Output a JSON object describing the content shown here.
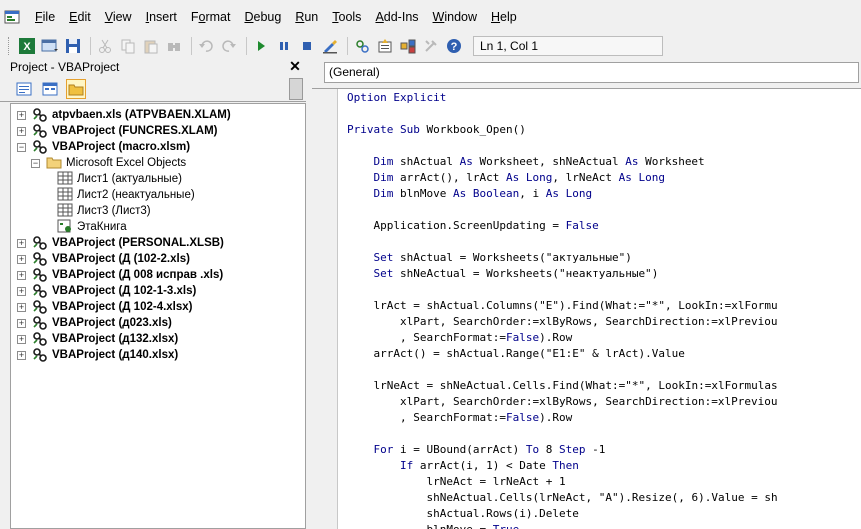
{
  "menu": [
    "File",
    "Edit",
    "View",
    "Insert",
    "Format",
    "Debug",
    "Run",
    "Tools",
    "Add-Ins",
    "Window",
    "Help"
  ],
  "menu_underline": [
    "F",
    "E",
    "V",
    "I",
    "o",
    "D",
    "R",
    "T",
    "A",
    "W",
    "H"
  ],
  "toolbar": {
    "position": "Ln 1, Col 1",
    "icons": [
      "excel-icon",
      "insert-userform-icon",
      "save-icon",
      "cut-icon",
      "copy-icon",
      "paste-icon",
      "find-icon",
      "undo-icon",
      "redo-icon",
      "run-icon",
      "break-icon",
      "reset-icon",
      "design-mode-icon",
      "project-explorer-icon",
      "properties-icon",
      "object-browser-icon",
      "toolbox-icon",
      "help-icon"
    ]
  },
  "project": {
    "title": "Project - VBAProject",
    "close_glyph": "✕",
    "tree": [
      {
        "label": "atpvbaen.xls (ATPVBAEN.XLAM)",
        "level": 0,
        "type": "project",
        "expander": "+",
        "bold": true
      },
      {
        "label": "VBAProject (FUNCRES.XLAM)",
        "level": 0,
        "type": "project",
        "expander": "+",
        "bold": true
      },
      {
        "label": "VBAProject (macro.xlsm)",
        "level": 0,
        "type": "project",
        "expander": "−",
        "bold": true
      },
      {
        "label": "Microsoft Excel Objects",
        "level": 1,
        "type": "folder",
        "expander": "−",
        "bold": false
      },
      {
        "label": "Лист1 (актуальные)",
        "level": 2,
        "type": "sheet",
        "expander": "",
        "bold": false
      },
      {
        "label": "Лист2 (неактуальные)",
        "level": 2,
        "type": "sheet",
        "expander": "",
        "bold": false
      },
      {
        "label": "Лист3 (Лист3)",
        "level": 2,
        "type": "sheet",
        "expander": "",
        "bold": false
      },
      {
        "label": "ЭтаКнига",
        "level": 2,
        "type": "workbook",
        "expander": "",
        "bold": false
      },
      {
        "label": "VBAProject (PERSONAL.XLSB)",
        "level": 0,
        "type": "project",
        "expander": "+",
        "bold": true
      },
      {
        "label": "VBAProject (Д (102-2.xls)",
        "level": 0,
        "type": "project",
        "expander": "+",
        "bold": true
      },
      {
        "label": "VBAProject (Д 008 исправ .xls)",
        "level": 0,
        "type": "project",
        "expander": "+",
        "bold": true
      },
      {
        "label": "VBAProject (Д 102-1-3.xls)",
        "level": 0,
        "type": "project",
        "expander": "+",
        "bold": true
      },
      {
        "label": "VBAProject (Д 102-4.xlsx)",
        "level": 0,
        "type": "project",
        "expander": "+",
        "bold": true
      },
      {
        "label": "VBAProject (д023.xls)",
        "level": 0,
        "type": "project",
        "expander": "+",
        "bold": true
      },
      {
        "label": "VBAProject (д132.xlsx)",
        "level": 0,
        "type": "project",
        "expander": "+",
        "bold": true
      },
      {
        "label": "VBAProject (д140.xlsx)",
        "level": 0,
        "type": "project",
        "expander": "+",
        "bold": true
      }
    ]
  },
  "code": {
    "object_dropdown": "(General)",
    "lines": [
      "Option Explicit",
      "",
      "Private Sub Workbook_Open()",
      "",
      "    Dim shActual As Worksheet, shNeActual As Worksheet",
      "    Dim arrAct(), lrAct As Long, lrNeAct As Long",
      "    Dim blnMove As Boolean, i As Long",
      "",
      "    Application.ScreenUpdating = False",
      "",
      "    Set shActual = Worksheets(\"актуальные\")",
      "    Set shNeActual = Worksheets(\"неактуальные\")",
      "",
      "    lrAct = shActual.Columns(\"E\").Find(What:=\"*\", LookIn:=xlFormu",
      "        xlPart, SearchOrder:=xlByRows, SearchDirection:=xlPreviou",
      "        , SearchFormat:=False).Row",
      "    arrAct() = shActual.Range(\"E1:E\" & lrAct).Value",
      "",
      "    lrNeAct = shNeActual.Cells.Find(What:=\"*\", LookIn:=xlFormulas",
      "        xlPart, SearchOrder:=xlByRows, SearchDirection:=xlPreviou",
      "        , SearchFormat:=False).Row",
      "",
      "    For i = UBound(arrAct) To 8 Step -1",
      "        If arrAct(i, 1) < Date Then",
      "            lrNeAct = lrNeAct + 1",
      "            shNeActual.Cells(lrNeAct, \"A\").Resize(, 6).Value = sh",
      "            shActual.Rows(i).Delete",
      "            blnMove = True"
    ],
    "keywords": [
      "Option",
      "Explicit",
      "Private",
      "Sub",
      "Dim",
      "As",
      "Long",
      "Boolean",
      "Set",
      "False",
      "For",
      "To",
      "Step",
      "If",
      "Then",
      "True"
    ]
  },
  "colors": {
    "keyword": "#00008b",
    "vba_icon": "#2a7d2a"
  }
}
